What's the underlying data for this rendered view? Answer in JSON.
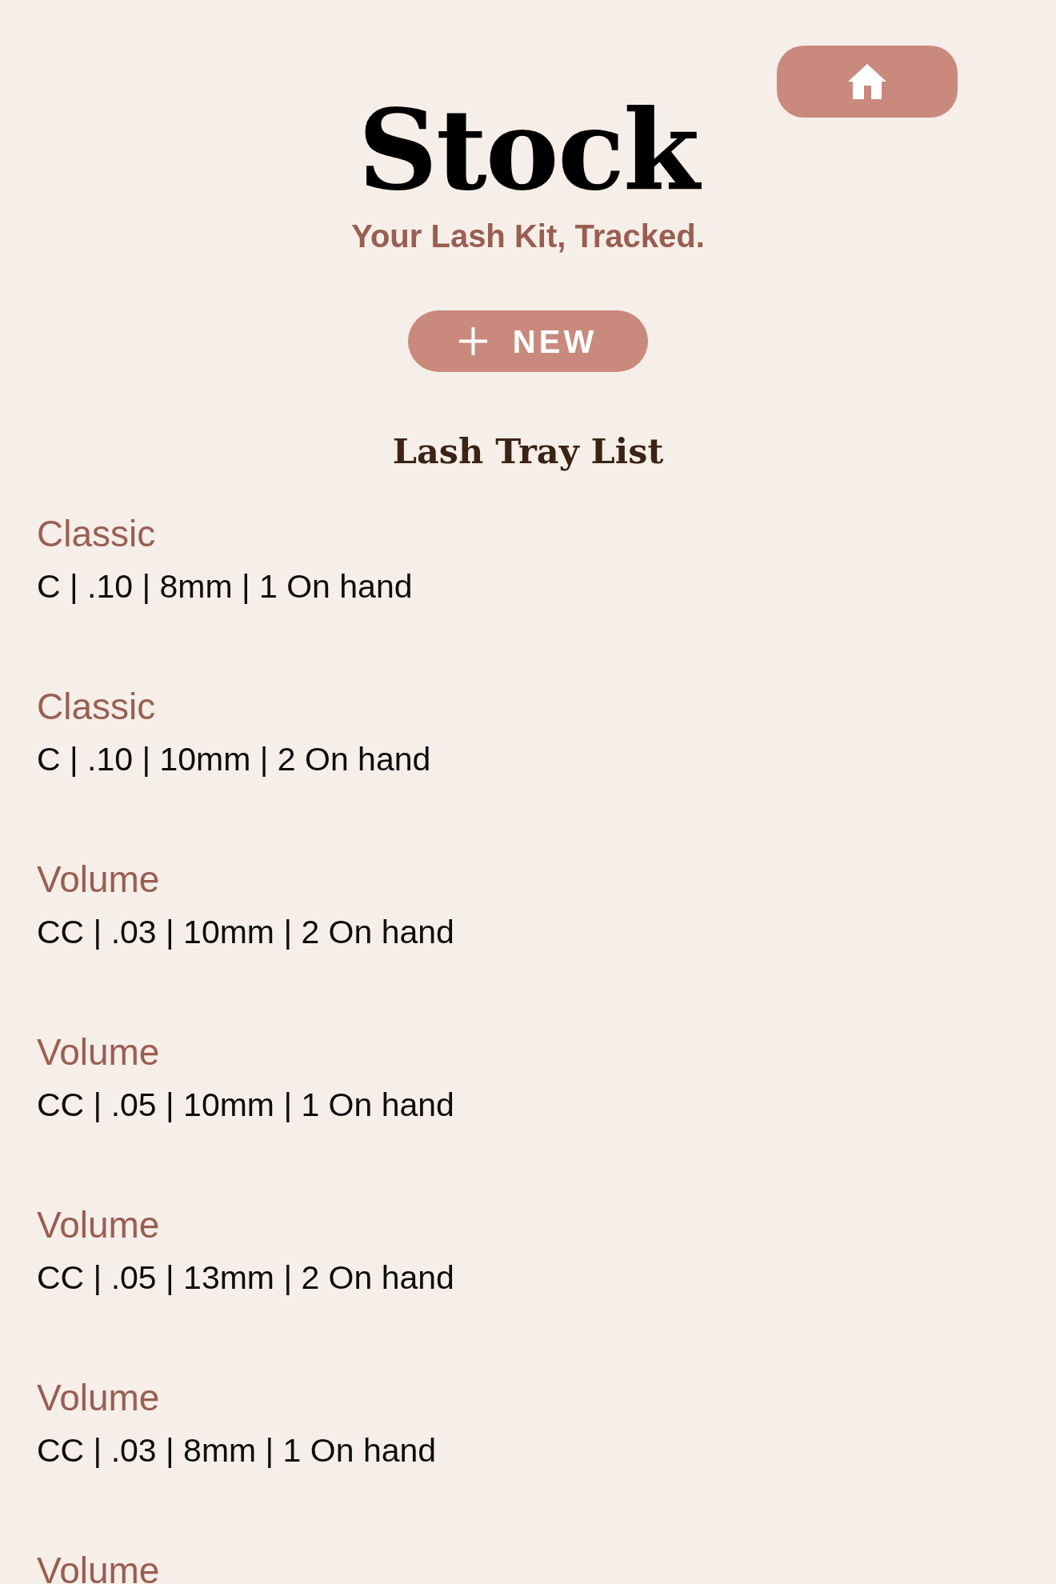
{
  "header": {
    "title": "Stock",
    "subtitle": "Your Lash Kit, Tracked."
  },
  "new_button": {
    "label": "NEW"
  },
  "list": {
    "title": "Lash Tray List",
    "items": [
      {
        "category": "Classic",
        "details": "C | .10 | 8mm | 1 On hand"
      },
      {
        "category": "Classic",
        "details": "C | .10 | 10mm | 2 On hand"
      },
      {
        "category": "Volume",
        "details": "CC | .03 | 10mm | 2 On hand"
      },
      {
        "category": "Volume",
        "details": "CC | .05 | 10mm | 1 On hand"
      },
      {
        "category": "Volume",
        "details": "CC | .05 | 13mm | 2 On hand"
      },
      {
        "category": "Volume",
        "details": "CC | .03 | 8mm | 1 On hand"
      },
      {
        "category": "Volume"
      }
    ]
  }
}
